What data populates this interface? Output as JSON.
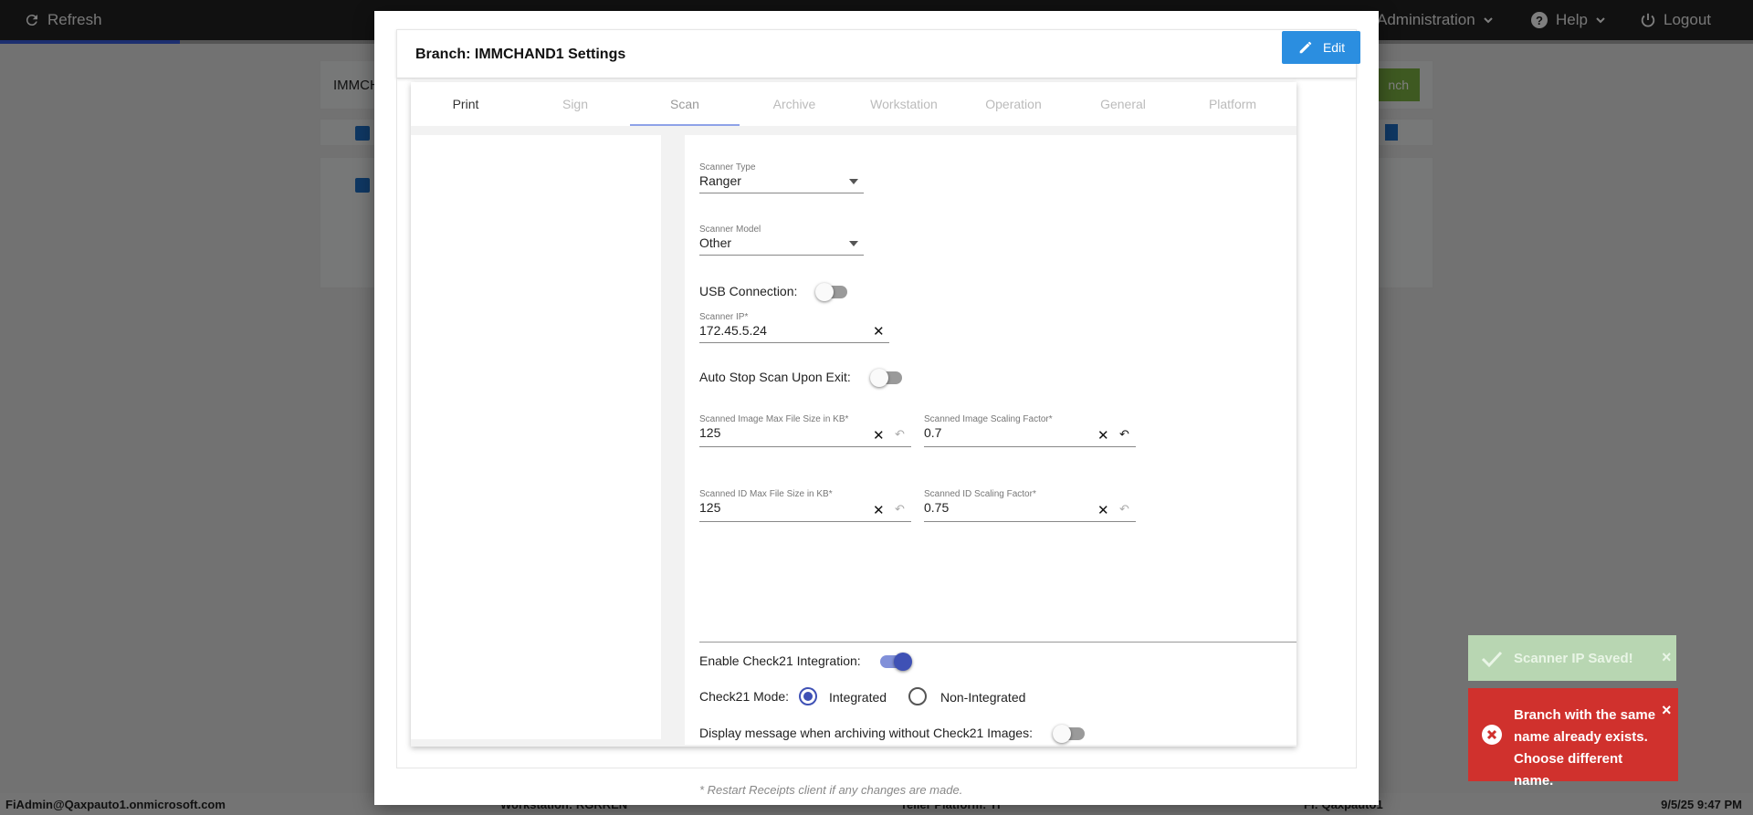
{
  "topbar": {
    "refresh_label": "Refresh",
    "administration_label": "Administration",
    "help_label": "Help",
    "logout_label": "Logout"
  },
  "background": {
    "branch_input_value": "IMMCH",
    "add_branch_label": "nch"
  },
  "footer": {
    "user": "FiAdmin@Qaxpauto1.onmicrosoft.com",
    "workstation": "Workstation: RGRREN",
    "teller_platform": "Teller Platform: Yi",
    "fi": "FI: Qaxpauto1",
    "datetime": "9/5/25 9:47 PM"
  },
  "modal": {
    "title": "Branch: IMMCHAND1 Settings",
    "edit_label": "Edit",
    "tabs": [
      {
        "label": "Print"
      },
      {
        "label": "Sign"
      },
      {
        "label": "Scan"
      },
      {
        "label": "Archive"
      },
      {
        "label": "Workstation"
      },
      {
        "label": "Operation"
      },
      {
        "label": "General"
      },
      {
        "label": "Platform"
      }
    ],
    "selected_tab": "Scan",
    "scan": {
      "scanner_type": {
        "label": "Scanner Type",
        "value": "Ranger"
      },
      "scanner_model": {
        "label": "Scanner Model",
        "value": "Other"
      },
      "usb_connection": {
        "label": "USB Connection:",
        "on": false
      },
      "scanner_ip": {
        "label": "Scanner IP*",
        "value": "172.45.5.24"
      },
      "auto_stop": {
        "label": "Auto Stop Scan Upon Exit:",
        "on": false
      },
      "image_max_size": {
        "label": "Scanned Image Max File Size in KB*",
        "value": "125"
      },
      "image_scaling": {
        "label": "Scanned Image Scaling Factor*",
        "value": "0.7"
      },
      "id_max_size": {
        "label": "Scanned ID Max File Size in KB*",
        "value": "125"
      },
      "id_scaling": {
        "label": "Scanned ID Scaling Factor*",
        "value": "0.75"
      },
      "check21_enable": {
        "label": "Enable Check21 Integration:",
        "on": true
      },
      "check21_mode": {
        "label": "Check21 Mode:",
        "options": [
          "Integrated",
          "Non-Integrated"
        ],
        "selected": "Integrated"
      },
      "display_message": {
        "label": "Display message when archiving without Check21 Images:",
        "on": false
      },
      "note": "* Restart Receipts client if any changes are made."
    }
  },
  "toasts": {
    "success": "Scanner IP Saved!",
    "error": "Branch with the same name already exists. Choose different name.",
    "close_glyph": "×"
  },
  "colors": {
    "primary": "#3f51b5",
    "edit_button": "#2b8ee0",
    "error_toast": "#d0312d",
    "success_toast": "#5cb85c",
    "add_branch": "#7cb342"
  }
}
